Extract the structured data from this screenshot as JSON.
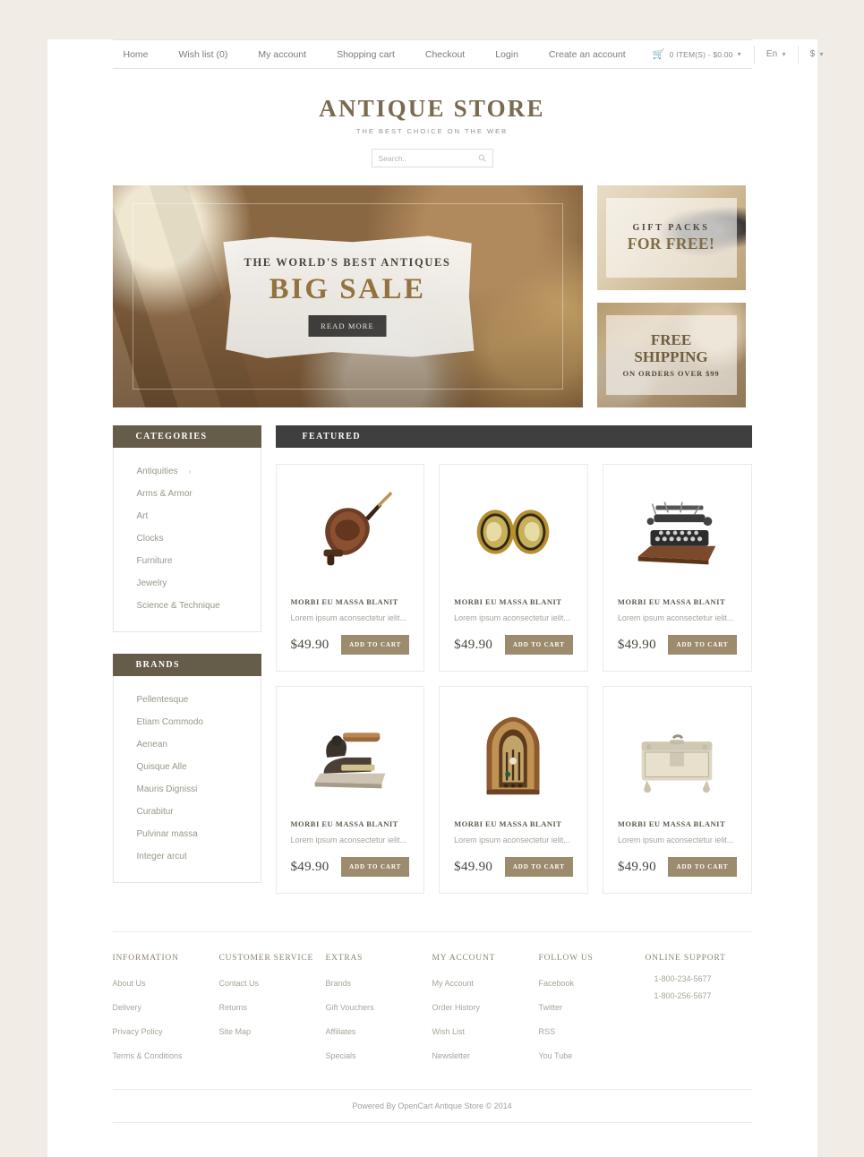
{
  "topbar": {
    "nav": [
      {
        "label": "Home"
      },
      {
        "label": "Wish list (0)"
      },
      {
        "label": "My account"
      },
      {
        "label": "Shopping cart"
      },
      {
        "label": "Checkout"
      },
      {
        "label": "Login"
      },
      {
        "label": "Create an account"
      }
    ],
    "cart_label": "0 ITEM(S) - $0.00",
    "language": "En",
    "currency": "$"
  },
  "header": {
    "brand": "ANTIQUE STORE",
    "tagline": "THE BEST CHOICE ON THE WEB",
    "search_placeholder": "Search..",
    "search_value": ""
  },
  "hero": {
    "subtitle": "THE WORLD'S BEST ANTIQUES",
    "title": "BIG SALE",
    "button": "READ MORE"
  },
  "side_banners": [
    {
      "line1": "GIFT PACKS",
      "line2": "FOR FREE!"
    },
    {
      "line1": "FREE",
      "line2": "SHIPPING",
      "line3": "ON ORDERS OVER $99"
    }
  ],
  "sidebar": {
    "categories": {
      "title": "CATEGORIES",
      "items": [
        {
          "label": "Antiquities",
          "has_children": true
        },
        {
          "label": "Arms & Armor",
          "has_children": false
        },
        {
          "label": "Art",
          "has_children": false
        },
        {
          "label": "Clocks",
          "has_children": false
        },
        {
          "label": "Furniture",
          "has_children": false
        },
        {
          "label": "Jewelry",
          "has_children": false
        },
        {
          "label": "Science & Technique",
          "has_children": false
        }
      ]
    },
    "brands": {
      "title": "BRANDS",
      "items": [
        {
          "label": "Pellentesque"
        },
        {
          "label": "Etiam Commodo"
        },
        {
          "label": "Aenean"
        },
        {
          "label": "Quisque Alle"
        },
        {
          "label": "Mauris Dignissi"
        },
        {
          "label": "Curabitur"
        },
        {
          "label": "Pulvinar massa"
        },
        {
          "label": "Integer arcut"
        }
      ]
    }
  },
  "featured": {
    "title": "FEATURED",
    "products": [
      {
        "name": "MORBI EU MASSA BLANIT",
        "desc": "Lorem ipsum aconsectetur ielit...",
        "price": "$49.90",
        "button": "ADD TO CART",
        "image": "antique-bellows-image"
      },
      {
        "name": "MORBI EU MASSA BLANIT",
        "desc": "Lorem ipsum aconsectetur ielit...",
        "price": "$49.90",
        "button": "ADD TO CART",
        "image": "gold-cameo-earrings-image"
      },
      {
        "name": "MORBI EU MASSA BLANIT",
        "desc": "Lorem ipsum aconsectetur ielit...",
        "price": "$49.90",
        "button": "ADD TO CART",
        "image": "antique-typewriter-image"
      },
      {
        "name": "MORBI EU MASSA BLANIT",
        "desc": "Lorem ipsum aconsectetur ielit...",
        "price": "$49.90",
        "button": "ADD TO CART",
        "image": "cast-iron-sad-iron-image"
      },
      {
        "name": "MORBI EU MASSA BLANIT",
        "desc": "Lorem ipsum aconsectetur ielit...",
        "price": "$49.90",
        "button": "ADD TO CART",
        "image": "vintage-cathedral-radio-image"
      },
      {
        "name": "MORBI EU MASSA BLANIT",
        "desc": "Lorem ipsum aconsectetur ielit...",
        "price": "$49.90",
        "button": "ADD TO CART",
        "image": "silver-casket-box-image"
      }
    ]
  },
  "footer": {
    "columns": [
      {
        "title": "INFORMATION",
        "links": [
          "About Us",
          "Delivery",
          "Privacy Policy",
          "Terms & Conditions"
        ]
      },
      {
        "title": "CUSTOMER SERVICE",
        "links": [
          "Contact Us",
          "Returns",
          "Site Map"
        ]
      },
      {
        "title": "EXTRAS",
        "links": [
          "Brands",
          "Gift Vouchers",
          "Affiliates",
          "Specials"
        ]
      },
      {
        "title": "MY ACCOUNT",
        "links": [
          "My Account",
          "Order History",
          "Wish List",
          "Newsletter"
        ]
      },
      {
        "title": "FOLLOW US",
        "links": [
          "Facebook",
          "Twitter",
          "RSS",
          "You Tube"
        ]
      },
      {
        "title": "ONLINE SUPPORT",
        "links": [
          "1-800-234-5677",
          "1-800-256-5677"
        ]
      }
    ],
    "copyright": "Powered By OpenCart  Antique Store © 2014"
  },
  "colors": {
    "page_background": "#f1ede6",
    "panel_header": "#655c4a",
    "section_header": "#3f3f3f",
    "brand_text": "#7a6a4f",
    "button_tan": "#9d8b6e",
    "hero_gold": "#94743f"
  }
}
